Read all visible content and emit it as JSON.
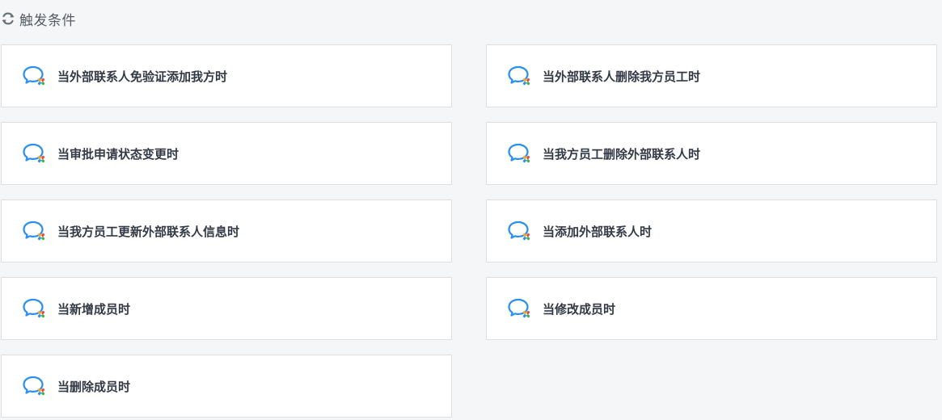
{
  "header": {
    "icon": "refresh-icon",
    "title": "触发条件"
  },
  "triggers": [
    {
      "label": "当外部联系人免验证添加我方时",
      "icon": "wecom-chat-icon"
    },
    {
      "label": "当外部联系人删除我方员工时",
      "icon": "wecom-chat-icon"
    },
    {
      "label": "当审批申请状态变更时",
      "icon": "wecom-chat-icon"
    },
    {
      "label": "当我方员工删除外部联系人时",
      "icon": "wecom-chat-icon"
    },
    {
      "label": "当我方员工更新外部联系人信息时",
      "icon": "wecom-chat-icon"
    },
    {
      "label": "当添加外部联系人时",
      "icon": "wecom-chat-icon"
    },
    {
      "label": "当新增成员时",
      "icon": "wecom-chat-icon"
    },
    {
      "label": "当修改成员时",
      "icon": "wecom-chat-icon"
    },
    {
      "label": "当删除成员时",
      "icon": "wecom-chat-icon"
    }
  ],
  "colors": {
    "icon_blue": "#2a8ff0",
    "icon_accents": [
      "#f5a623",
      "#e94e3c",
      "#3bb54a",
      "#2a8ff0"
    ]
  }
}
